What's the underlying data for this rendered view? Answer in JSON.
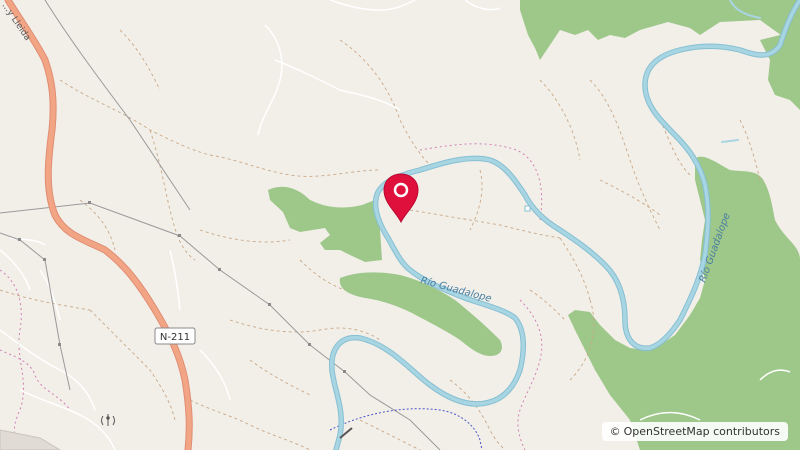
{
  "map": {
    "attribution": {
      "symbol": "©",
      "text": "OpenStreetMap contributors"
    },
    "road_shield": "N-211",
    "road_label_partial": "...y Lleida",
    "river_label_main": "Río Guadalope",
    "river_label_east": "Río Guadalope",
    "marker": {
      "icon": "location-pin-icon",
      "color": "#e0103c"
    },
    "colors": {
      "background": "#f2efe9",
      "forest": "#9ec78a",
      "river": "#a8d5e2",
      "river_edge": "#86bfd3",
      "primary_road": "#f2a585",
      "primary_road_edge": "#e08d72",
      "track": "#c9a886",
      "power_line": "#9a9a9a",
      "boundary": "#d27fb5",
      "water_dashed": "#4a57c8"
    }
  }
}
